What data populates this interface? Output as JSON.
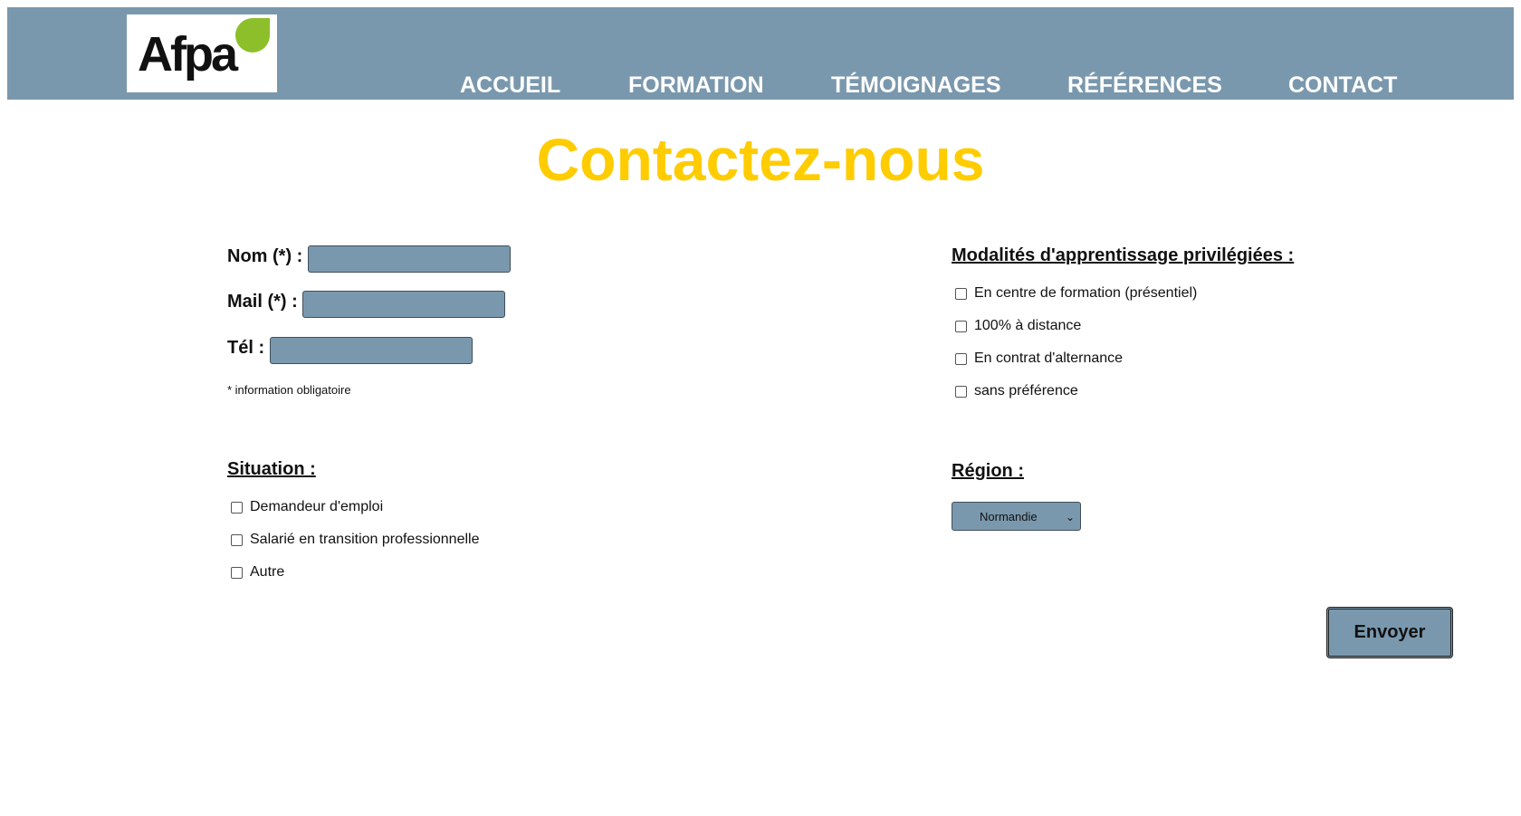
{
  "header": {
    "logo_text": "Afpa",
    "nav": [
      "ACCUEIL",
      "FORMATION",
      "TÉMOIGNAGES",
      "RÉFÉRENCES",
      "CONTACT"
    ]
  },
  "title": "Contactez-nous",
  "form": {
    "name_label": "Nom (*) :",
    "name_value": "",
    "mail_label": "Mail (*) :",
    "mail_value": "",
    "tel_label": "Tél :",
    "tel_value": "",
    "required_note": "* information obligatoire"
  },
  "situation": {
    "title": "Situation :",
    "options": [
      "Demandeur d'emploi",
      "Salarié en transition professionnelle",
      "Autre"
    ]
  },
  "modalities": {
    "title": "Modalités d'apprentissage privilégiées :",
    "options": [
      "En centre de formation (présentiel)",
      "100% à distance",
      "En contrat d'alternance",
      "sans préférence"
    ]
  },
  "region": {
    "title": "Région :",
    "selected": "Normandie"
  },
  "submit_label": "Envoyer",
  "colors": {
    "header_bg": "#7a98ad",
    "title": "#ffcc00",
    "logo_leaf": "#8cbf2a"
  }
}
